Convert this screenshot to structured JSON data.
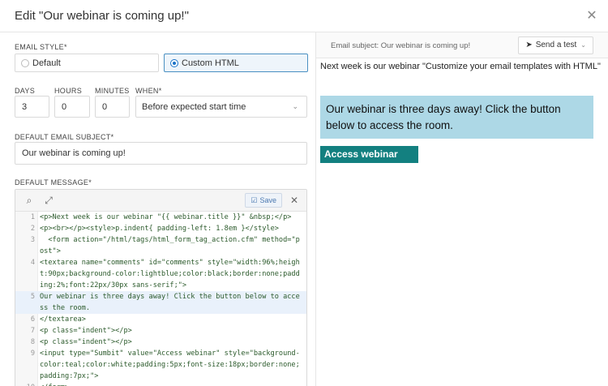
{
  "dialog": {
    "title": "Edit \"Our webinar is coming up!\""
  },
  "email_style": {
    "label": "EMAIL STYLE*",
    "options": [
      {
        "label": "Default",
        "selected": false
      },
      {
        "label": "Custom HTML",
        "selected": true
      }
    ]
  },
  "timing": {
    "days_label": "DAYS",
    "days_value": "3",
    "hours_label": "HOURS",
    "hours_value": "0",
    "minutes_label": "MINUTES",
    "minutes_value": "0",
    "when_label": "WHEN*",
    "when_value": "Before expected start time"
  },
  "subject": {
    "label": "DEFAULT EMAIL SUBJECT*",
    "value": "Our webinar is coming up!"
  },
  "message": {
    "label": "DEFAULT MESSAGE*",
    "save_label": "Save",
    "code_lines": [
      {
        "n": "1",
        "text": "<p>Next week is our webinar \"{{ webinar.title }}\" &nbsp;</p>",
        "highlight": false
      },
      {
        "n": "2",
        "text": "<p><br></p><style>p.indent{ padding-left: 1.8em }</style>",
        "highlight": false
      },
      {
        "n": "3",
        "text": "  <form action=\"/html/tags/html_form_tag_action.cfm\" method=\"post\">",
        "highlight": false
      },
      {
        "n": "4",
        "text": "<textarea name=\"comments\" id=\"comments\" style=\"width:96%;height:90px;background-color:lightblue;color:black;border:none;padding:2%;font:22px/30px sans-serif;\">",
        "highlight": false
      },
      {
        "n": "5",
        "text": "Our webinar is three days away! Click the button below to access the room.",
        "highlight": true
      },
      {
        "n": "6",
        "text": "</textarea>",
        "highlight": false
      },
      {
        "n": "7",
        "text": "<p class=\"indent\"></p>",
        "highlight": false
      },
      {
        "n": "8",
        "text": "<p class=\"indent\"></p>",
        "highlight": false
      },
      {
        "n": "9",
        "text": "<input type=\"Sumbit\" value=\"Access webinar\" style=\"background-color:teal;color:white;padding:5px;font-size:18px;border:none;padding:7px;\">",
        "highlight": false
      },
      {
        "n": "10",
        "text": "</form>",
        "highlight": false
      }
    ]
  },
  "preview": {
    "subject_text": "Email subject: Our webinar is coming up!",
    "send_test_label": "Send a test",
    "intro": "Next week is our webinar \"Customize your email templates with HTML\"",
    "callout": "Our webinar is three days away! Click the button below to access the room.",
    "button_label": "Access webinar",
    "callout_bg": "#add8e6",
    "button_bg": "#138080"
  }
}
